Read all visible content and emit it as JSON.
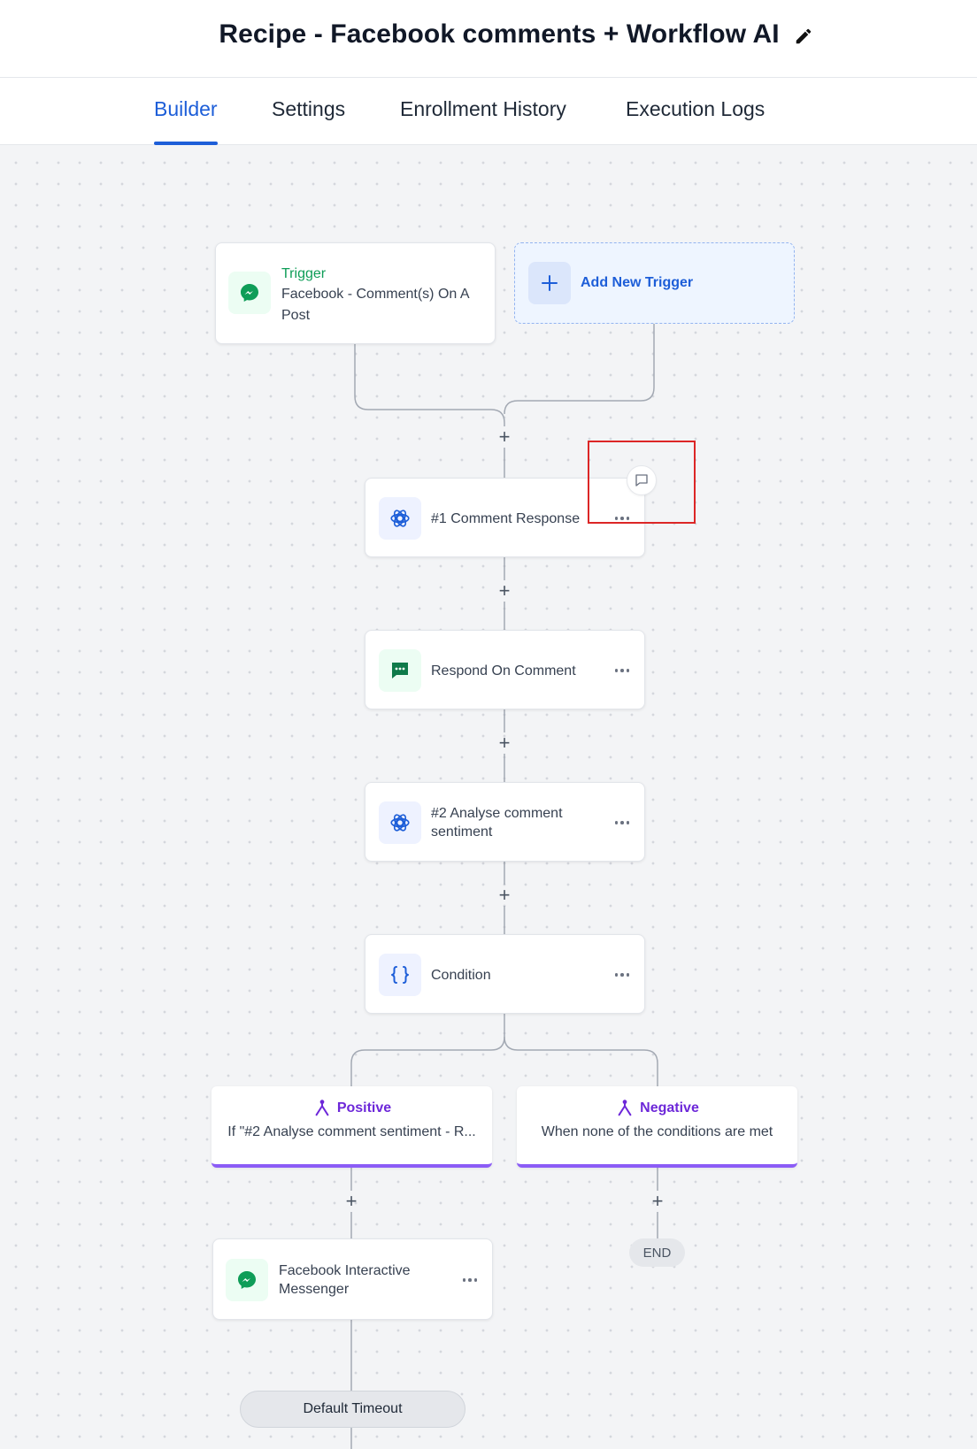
{
  "header": {
    "title": "Recipe - Facebook comments + Workflow AI"
  },
  "tabs": [
    {
      "label": "Builder",
      "active": true
    },
    {
      "label": "Settings",
      "active": false
    },
    {
      "label": "Enrollment History",
      "active": false
    },
    {
      "label": "Execution Logs",
      "active": false
    }
  ],
  "trigger": {
    "heading": "Trigger",
    "line1": "Facebook - Comment(s) On A",
    "line2": "Post",
    "icon": "messenger-icon"
  },
  "add_trigger": {
    "label": "Add New Trigger",
    "icon": "plus-icon"
  },
  "actions": [
    {
      "line1": "#1 Comment Response",
      "line2": "",
      "icon": "openai-icon"
    },
    {
      "line1": "Respond On Comment",
      "line2": "",
      "icon": "comment-bubble-icon"
    },
    {
      "line1": "#2 Analyse comment",
      "line2": "sentiment",
      "icon": "openai-icon"
    },
    {
      "line1": "Condition",
      "line2": "",
      "icon": "curly-braces-icon"
    }
  ],
  "branches": [
    {
      "title": "Positive",
      "desc": "If \"#2 Analyse comment sentiment - R...",
      "icon": "branch-icon"
    },
    {
      "title": "Negative",
      "desc": "When none of the conditions are met",
      "icon": "branch-icon"
    }
  ],
  "branch_action": {
    "line1": "Facebook Interactive",
    "line2": "Messenger",
    "icon": "messenger-icon"
  },
  "end_label": "END",
  "timeout_label": "Default Timeout",
  "plus_symbol": "+",
  "colors": {
    "accent": "#1d5ed8",
    "branch": "#8b5cf6",
    "trigger_green": "#0f9d58",
    "highlight": "#dc2626"
  }
}
